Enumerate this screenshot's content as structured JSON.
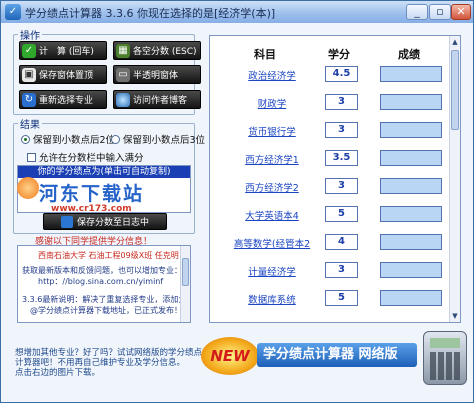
{
  "window": {
    "title": "学分绩点计算器 3.3.6   你现在选择的是[经济学(本)]"
  },
  "operations": {
    "legend": "操作",
    "buttons": [
      {
        "label": "计　算 (回车)",
        "icon": "check-icon"
      },
      {
        "label": "各空分数 (ESC)",
        "icon": "calculator-icon"
      },
      {
        "label": "保存窗体置顶",
        "icon": "pin-icon"
      },
      {
        "label": "半透明窗体",
        "icon": "window-icon"
      },
      {
        "label": "重新选择专业",
        "icon": "refresh-icon"
      },
      {
        "label": "访问作者博客",
        "icon": "globe-icon"
      }
    ]
  },
  "results": {
    "legend": "结果",
    "radio1": "保留到小数点后2位",
    "radio2": "保留到小数点后3位",
    "checkbox": "允许在分数栏中输入满分",
    "result_header": "你的学分绩点为(单击可自动复制)",
    "save_button": "保存分数至日志中"
  },
  "watermark": {
    "text": "河东下载站",
    "url": "www.cr173.com"
  },
  "info": {
    "thanks": "感谢以下同学提供学分信息！",
    "lines": [
      "西南石油大学  石油工程09级X班 任克明",
      "获取最新版本和反馈问题，也可以增加专业：",
      "http：//blog.sina.com.cn/yiminf",
      "3.3.6最新说明：解决了重复选择专业，添加大家的支持，",
      "　@学分绩点计算器下载地址，已正式发布！　欢迎下载！"
    ]
  },
  "footnote": {
    "line1": "想增加其他专业？好了吗？试试网络版的学分绩点",
    "line2": "计算器吧！不用再自己维护专业及学分信息。",
    "line3": "点击右边的图片下载。"
  },
  "table": {
    "headers": {
      "subject": "科目",
      "credit": "学分",
      "score": "成绩"
    },
    "rows": [
      {
        "subject": "政治经济学",
        "credit": "4.5",
        "score": ""
      },
      {
        "subject": "财政学",
        "credit": "3",
        "score": ""
      },
      {
        "subject": "货币银行学",
        "credit": "3",
        "score": ""
      },
      {
        "subject": "西方经济学1",
        "credit": "3.5",
        "score": ""
      },
      {
        "subject": "西方经济学2",
        "credit": "3",
        "score": ""
      },
      {
        "subject": "大学英语本4",
        "credit": "5",
        "score": ""
      },
      {
        "subject": "高等数学(经管本2",
        "credit": "4",
        "score": ""
      },
      {
        "subject": "计量经济学",
        "credit": "3",
        "score": ""
      },
      {
        "subject": "数据库系统",
        "credit": "5",
        "score": ""
      }
    ]
  },
  "banner": {
    "new_badge": "NEW",
    "text": "学分绩点计算器 网络版"
  }
}
